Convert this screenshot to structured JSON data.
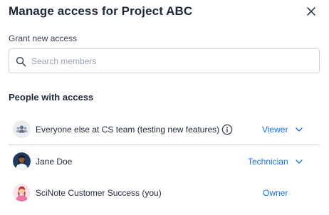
{
  "dialog": {
    "title": "Manage access for Project ABC"
  },
  "grant": {
    "label": "Grant new access",
    "search_placeholder": "Search members",
    "search_value": ""
  },
  "people": {
    "section_title": "People with access",
    "members": [
      {
        "name": "Everyone else at CS team (testing new features)",
        "role": "Viewer",
        "has_dropdown": true,
        "has_info": true,
        "avatar": "group-icon"
      },
      {
        "name": "Jane Doe",
        "role": "Technician",
        "has_dropdown": true,
        "has_info": false,
        "avatar": "user-avatar"
      },
      {
        "name": "SciNote Customer Success  (you)",
        "role": "Owner",
        "has_dropdown": false,
        "has_info": false,
        "avatar": "user-avatar"
      }
    ]
  },
  "colors": {
    "accent": "#1570ef",
    "text": "#1d2939",
    "border": "#d0d5dd"
  }
}
